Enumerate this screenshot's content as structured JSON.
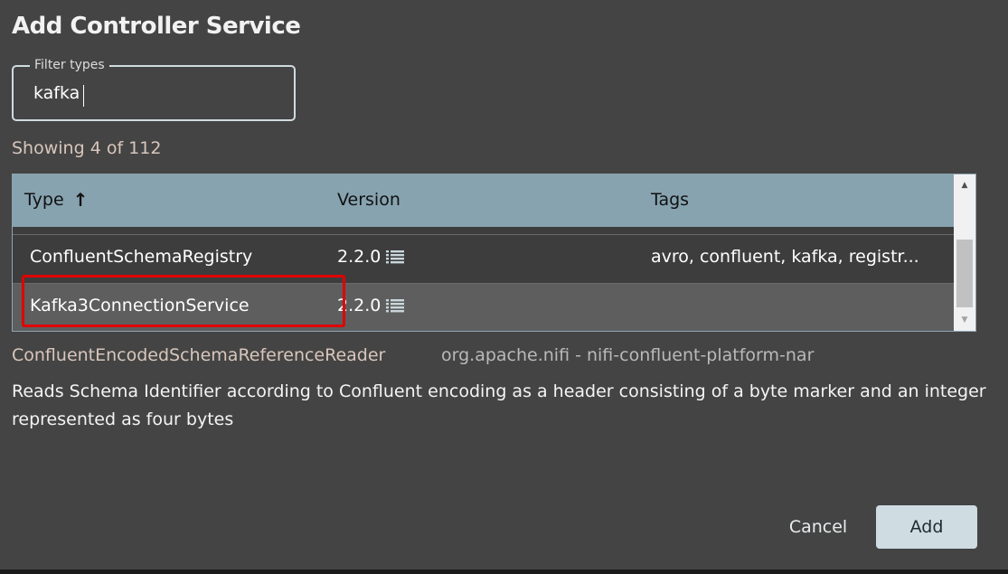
{
  "dialog": {
    "title": "Add Controller Service"
  },
  "filter": {
    "label": "Filter types",
    "value": "kafka"
  },
  "results": {
    "showing_text": "Showing 4 of 112"
  },
  "table": {
    "columns": [
      {
        "label": "Type",
        "sort_icon": "arrow-up-icon",
        "sort_glyph": "↑"
      },
      {
        "label": "Version"
      },
      {
        "label": "Tags"
      }
    ],
    "rows": [
      {
        "type": "ConfluentSchemaRegistry",
        "version": "2.2.0",
        "tags": "avro, confluent, kafka, registr..."
      },
      {
        "type": "Kafka3ConnectionService",
        "version": "2.2.0",
        "tags": ""
      }
    ]
  },
  "selection": {
    "name": "ConfluentEncodedSchemaReferenceReader",
    "bundle": "org.apache.nifi - nifi-confluent-platform-nar",
    "description": "Reads Schema Identifier according to Confluent encoding as a header consisting of a byte marker and an integer represented as four bytes"
  },
  "buttons": {
    "cancel": "Cancel",
    "add": "Add"
  },
  "colors": {
    "background": "#444444",
    "header": "#87a3b0",
    "selected_row": "#5e5e5e",
    "accent_text": "#d8c6bc",
    "highlight": "#e00000",
    "add_button": "#cfdce2"
  }
}
